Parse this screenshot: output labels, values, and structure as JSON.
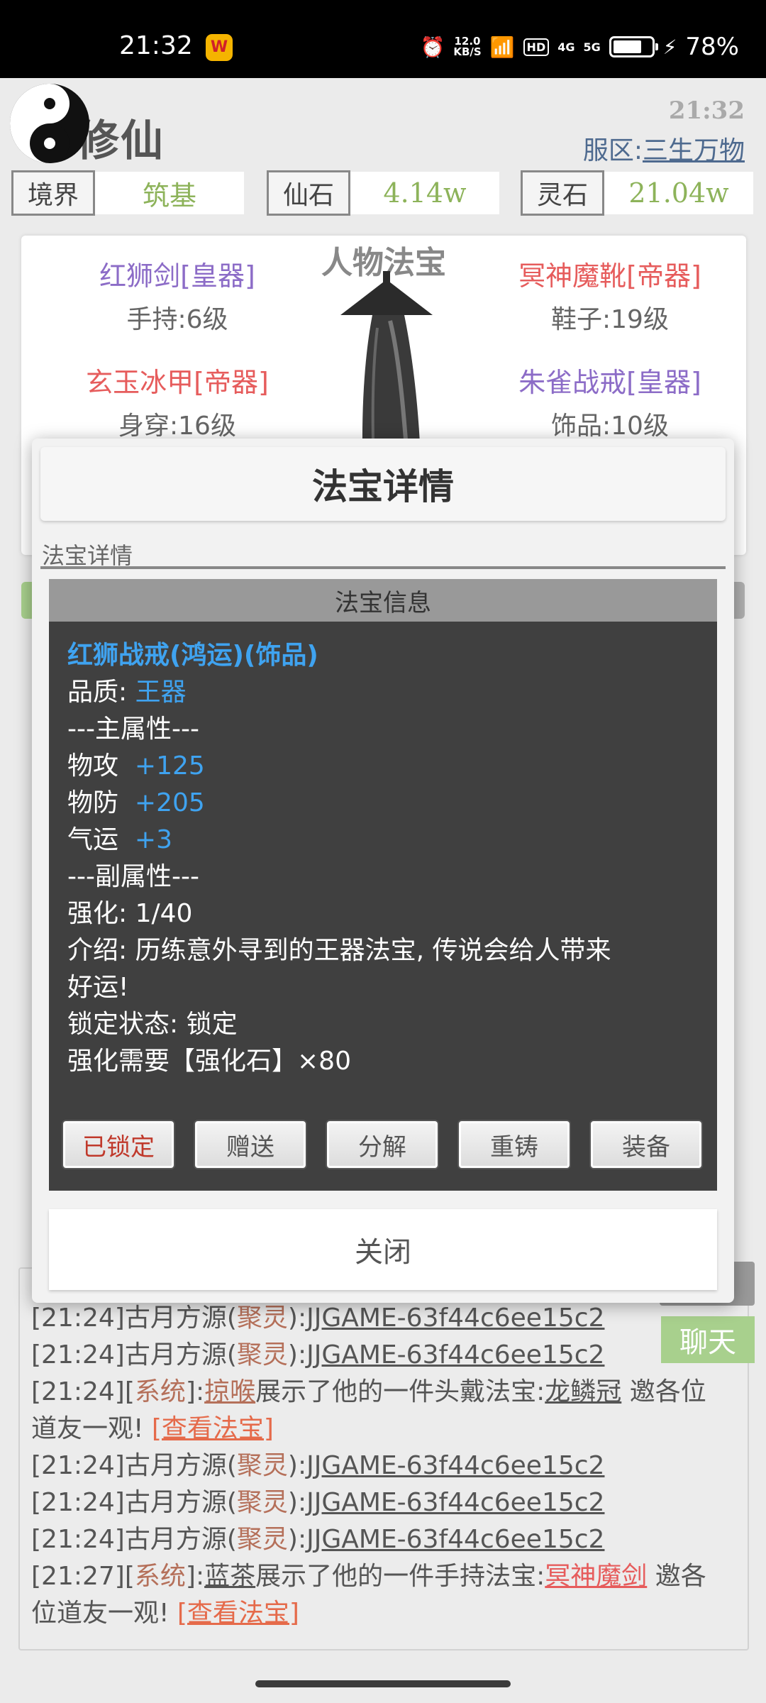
{
  "status_bar": {
    "time": "21:32",
    "net_speed_top": "12.0",
    "net_speed_unit": "KB/S",
    "hd": "HD",
    "sig1": "4G",
    "sig2": "5G",
    "battery": "78%"
  },
  "header": {
    "game_title": "修仙",
    "clock": "21:32",
    "server_label": "服区:",
    "server_name": "三生万物"
  },
  "stats": {
    "realm_label": "境界",
    "realm_value": "筑基",
    "xianshi_label": "仙石",
    "xianshi_value": "4.14w",
    "lingshi_label": "灵石",
    "lingshi_value": "21.04w"
  },
  "equipment": {
    "title": "人物法宝",
    "items": [
      {
        "name": "红狮剑[皇器]",
        "slot": "手持:6级"
      },
      {
        "name": "冥神魔靴[帝器]",
        "slot": "鞋子:19级"
      },
      {
        "name": "玄玉冰甲[帝器]",
        "slot": "身穿:16级"
      },
      {
        "name": "朱雀战戒[皇器]",
        "slot": "饰品:10级"
      }
    ]
  },
  "colors": {
    "purple_grade": "#8c6cc7",
    "red_grade": "#e65c5c",
    "accent_green": "#8db35a",
    "info_blue": "#3fa3f0"
  },
  "modal": {
    "title": "法宝详情",
    "subtitle": "法宝详情",
    "info_header": "法宝信息",
    "item_title": "红狮战戒(鸿运)(饰品)",
    "quality_label": "品质:",
    "quality_value": "王器",
    "main_attr_header": "---主属性---",
    "attrs": [
      {
        "label": "物攻",
        "value": "+125"
      },
      {
        "label": "物防",
        "value": "+205"
      },
      {
        "label": "气运",
        "value": "+3"
      }
    ],
    "sub_attr_header": "---副属性---",
    "enhance": "强化: 1/40",
    "intro_line1": "介绍: 历练意外寻到的王器法宝, 传说会给人带来",
    "intro_line2": "好运!",
    "lock_state": "锁定状态: 锁定",
    "enhance_need": "强化需要【强化石】×80",
    "buttons": {
      "locked": "已锁定",
      "gift": "赠送",
      "decompose": "分解",
      "recast": "重铸",
      "equip": "装备"
    },
    "close": "关闭"
  },
  "chat": {
    "button": "聊天",
    "lines": [
      {
        "time": "[21:24]",
        "user": "古月方源",
        "tag": "聚灵",
        "msg": "JJGAME-63f44c6ee15c2"
      },
      {
        "time": "[21:24]",
        "user": "古月方源",
        "tag": "聚灵",
        "msg": "JJGAME-63f44c6ee15c2"
      },
      {
        "time": "[21:24]",
        "tag": "系统",
        "name": "掠喉",
        "text": "展示了他的一件头戴法宝:",
        "item": "龙鳞冠",
        "tail": "邀各位",
        "tail2": "道友一观!",
        "link": "[查看法宝]"
      },
      {
        "time": "[21:24]",
        "user": "古月方源",
        "tag": "聚灵",
        "msg": "JJGAME-63f44c6ee15c2"
      },
      {
        "time": "[21:24]",
        "user": "古月方源",
        "tag": "聚灵",
        "msg": "JJGAME-63f44c6ee15c2"
      },
      {
        "time": "[21:24]",
        "user": "古月方源",
        "tag": "聚灵",
        "msg": "JJGAME-63f44c6ee15c2"
      },
      {
        "time": "[21:27]",
        "tag": "系统",
        "name": "蓝茶",
        "text": "展示了他的一件手持法宝:",
        "item": "冥神魔剑",
        "tail": "邀各",
        "tail2": "位道友一观!",
        "link": "[查看法宝]"
      }
    ]
  }
}
